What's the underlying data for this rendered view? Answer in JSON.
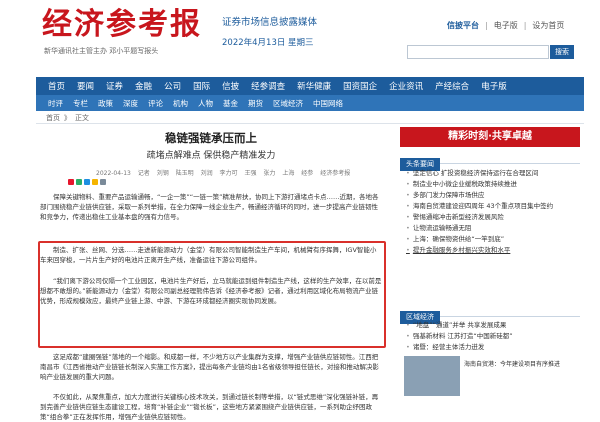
{
  "header": {
    "logo": "经济参考报",
    "slogan": "新华通讯社主管主办 邓小平题写报头",
    "site_desc": "证券市场信息披露媒体",
    "date": "2022年4月13日 星期三",
    "links": [
      "信披平台",
      "电子版",
      "设为首页"
    ],
    "search_button": "搜索"
  },
  "nav1": [
    "首页",
    "要闻",
    "证券",
    "金融",
    "公司",
    "国际",
    "信披",
    "经参调查",
    "新华健康",
    "国资国企",
    "企业资讯",
    "产经综合",
    "电子版"
  ],
  "nav2": [
    "时评",
    "专栏",
    "政策",
    "深度",
    "评论",
    "机构",
    "人物",
    "基金",
    "期货",
    "区域经济",
    "中国网络"
  ],
  "breadcrumb": [
    "首页",
    "》",
    "正文"
  ],
  "article": {
    "title": "稳链强链承压而上",
    "subtitle": "疏堵点解难点  保供稳产精准发力",
    "meta": [
      "2022-04-13",
      "记者",
      "刘钢",
      "陆玉明",
      "刘润",
      "李力可",
      "王强",
      "张力",
      "上海",
      "经参",
      "经济参考报"
    ],
    "paragraphs": [
      "保障关键物料、重要产品运输通畅，“一企一策”“一链一策”精准帮扶，协同上下游打通堵点卡点……近期，各地各部门围绕稳产业链供应链，采取一系列举措，在全力保障一线企业生产，畅通经济循环的同时，进一步提高产业链韧性和竞争力，传递出稳住工业基本盘的强有力信号。",
      "制造、扩张、丝网、分选……走进新能源动力（金堂）有限公司智能制造生产车间，机械臂有序挥舞，IGV智能小车来回穿梭，一片片生产好的电池片正离开生产线，准备运往下游公司组件。",
      "“我们离下游公司仅隔一个工业园区，电池片生产好后，立马就能运到组件制造生产线，这样的生产效率，在以前是想都不敢想的。”新能源动力（金堂）有限公司副总经理熊伟告诉《经济参考报》记者，通过利用区域化布局物流产业链优势，形成规模效应，最终产业链上游、中游、下游在环成都经济圈实现协同发展。",
      "这足成都“建圈强链”落地的一个缩影。和成都一样，不少地方以产业集群为支撑，增强产业链供应链韧性。江西把南昌市《江西省推动产业链链长制深入实施工作方案》，提出每条产业链均由1名省级领导担任链长，对接和推动解决影响产业链发展的重大问题。",
      "不仅如此，从聚焦重点，加大力度进行关键核心技术攻关，到通过链长制等举措，以“链式思维”深化强链补链，再到完善产业链供应链生态建设工程，培育“补链企业”“锻长板”，这些地方紧紧围绕产业链供应链，一系列助企纾困政策“组合拳”正在发挥作用，增强产业链供应链韧性。"
    ]
  },
  "sidebar": {
    "ad_text": "精彩时刻·共享卓越",
    "section1_title": "头条要闻",
    "news1": [
      "坚定信心 扩投资稳经济保持运行在合理区间",
      "制造业中小微企业缓税政策持续推进",
      "多部门发力保障市场供应",
      "海南自贸港建设迎四周年 43个重点项目集中签约",
      "警惕通缩冲击新型经济发展风险",
      "让物流运输畅通无阻",
      "上海：确保物资供给“一竿到底”",
      "提升金融服务乡村振兴实效和水平"
    ],
    "section2_title": "区域经济",
    "news2": [
      "“地盘”“通道”并举 共享发展成果",
      "强基新材料 江苏打造“中国新硅都”",
      "诸暨：经营主体活力迸发"
    ],
    "photo_caption": "海南自贸港：今年建设项目有序推进"
  }
}
